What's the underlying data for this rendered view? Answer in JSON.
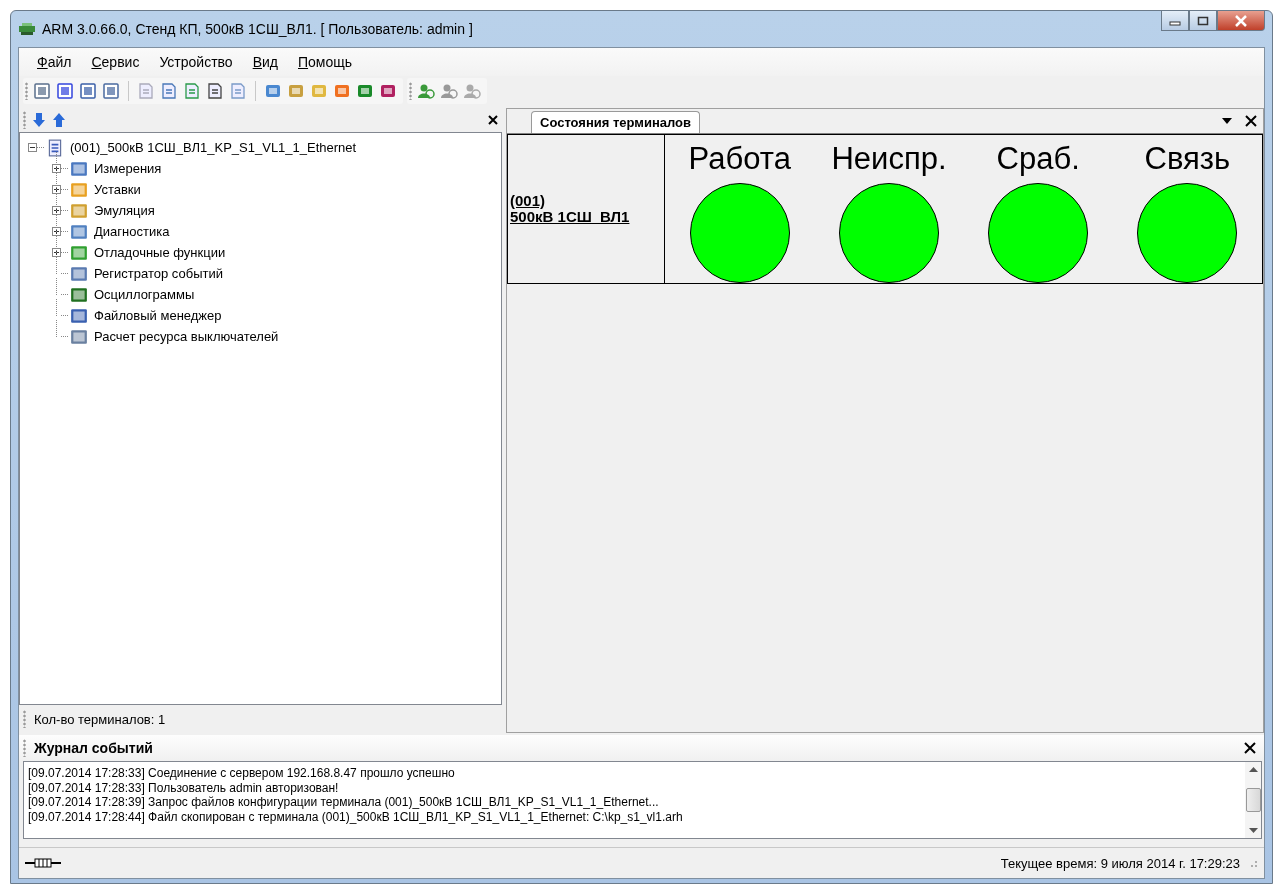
{
  "window": {
    "title": "ARM 3.0.66.0, Стенд КП, 500кВ 1СШ_ВЛ1. [ Пользователь: admin ]"
  },
  "menu": [
    {
      "label": "Файл",
      "mnemonic": true
    },
    {
      "label": "Сервис",
      "mnemonic": true
    },
    {
      "label": "Устройство",
      "mnemonic": false
    },
    {
      "label": "Вид",
      "mnemonic": true
    },
    {
      "label": "Помощь",
      "mnemonic": true
    }
  ],
  "tree": {
    "root": {
      "label": "(001)_500кВ 1СШ_ВЛ1_KP_S1_VL1_1_Ethernet",
      "expanded": true,
      "children": [
        {
          "label": "Измерения",
          "kind": "group"
        },
        {
          "label": "Уставки",
          "kind": "group"
        },
        {
          "label": "Эмуляция",
          "kind": "group"
        },
        {
          "label": "Диагностика",
          "kind": "group"
        },
        {
          "label": "Отладочные функции",
          "kind": "group"
        },
        {
          "label": "Регистратор событий",
          "kind": "leaf"
        },
        {
          "label": "Осциллограммы",
          "kind": "leaf"
        },
        {
          "label": "Файловый менеджер",
          "kind": "leaf"
        },
        {
          "label": "Расчет ресурса выключателей",
          "kind": "leaf"
        }
      ]
    },
    "footer": "Кол-во терминалов: 1"
  },
  "tabs": [
    {
      "label": "Состояния терминалов",
      "selected": true
    }
  ],
  "terminal": {
    "name_lines": [
      "(001)",
      "500кВ 1СШ_ВЛ1"
    ],
    "indicators": [
      {
        "label": "Работа",
        "color": "#00ff00"
      },
      {
        "label": "Неиспр.",
        "color": "#00ff00"
      },
      {
        "label": "Сраб.",
        "color": "#00ff00"
      },
      {
        "label": "Связь",
        "color": "#00ff00"
      }
    ]
  },
  "event_log": {
    "title": "Журнал событий",
    "lines": [
      "[09.07.2014 17:28:33] Соединение с сервером 192.168.8.47 прошло успешно",
      "[09.07.2014 17:28:33] Пользователь admin авторизован!",
      "[09.07.2014 17:28:39] Запрос файлов конфигурации терминала (001)_500кВ 1СШ_ВЛ1_KP_S1_VL1_1_Ethernet...",
      "[09.07.2014 17:28:44] Файл скопирован с терминала (001)_500кВ 1СШ_ВЛ1_KP_S1_VL1_1_Ethernet: C:\\kp_s1_vl1.arh"
    ]
  },
  "status_bar": {
    "time": "Текущее время: 9 июля 2014 г. 17:29:23"
  }
}
